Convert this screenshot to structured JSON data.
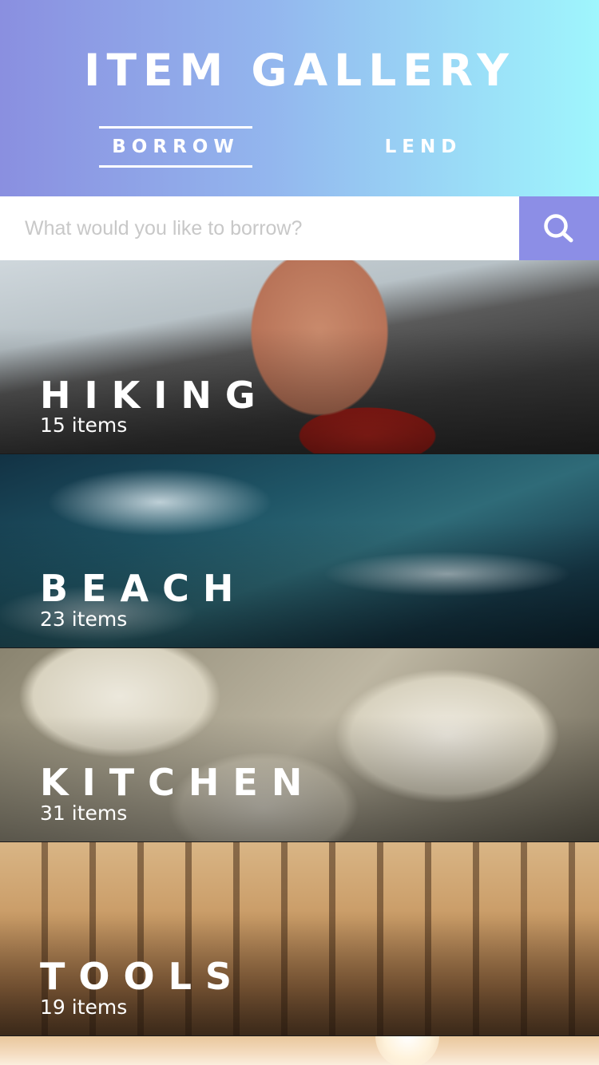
{
  "header": {
    "title": "ITEM GALLERY",
    "tabs": [
      {
        "label": "BORROW",
        "active": true
      },
      {
        "label": "LEND",
        "active": false
      }
    ]
  },
  "search": {
    "placeholder": "What would you like to borrow?",
    "icon": "search-icon",
    "button_color": "#8c8ee6"
  },
  "categories": [
    {
      "name": "HIKING",
      "count": "15 items"
    },
    {
      "name": "BEACH",
      "count": "23 items"
    },
    {
      "name": "KITCHEN",
      "count": "31 items"
    },
    {
      "name": "TOOLS",
      "count": "19 items"
    }
  ],
  "colors": {
    "header_gradient_start": "#8a8fe0",
    "header_gradient_end": "#9ff6fd"
  }
}
